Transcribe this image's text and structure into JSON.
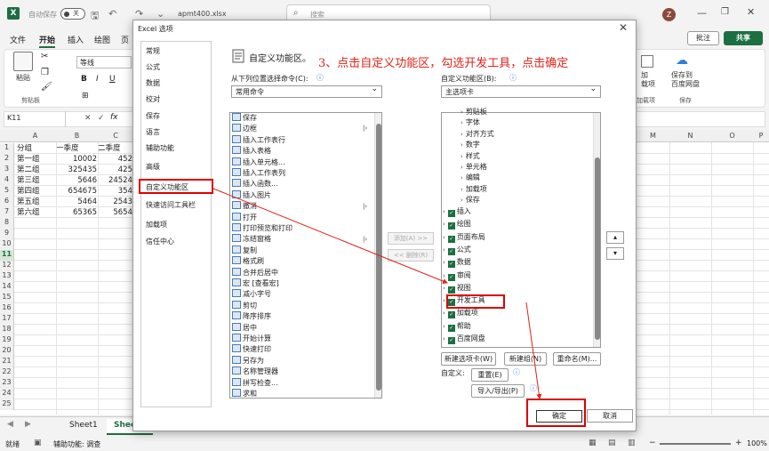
{
  "titlebar": {
    "autosave": "自动保存",
    "toggle": "关",
    "filename": "apmt400.xlsx",
    "search_placeholder": "搜索",
    "avatar": "Z"
  },
  "menu": [
    "文件",
    "开始",
    "插入",
    "绘图",
    "页"
  ],
  "header_buttons": {
    "comment": "批注",
    "share": "共享"
  },
  "ribbon": {
    "paste": "粘贴",
    "clipboard": "剪贴板",
    "font_name": "等线",
    "right_label1": "加\n载项",
    "addin_group": "加载项",
    "save_baidu": "保存到\n百度网盘",
    "save_group": "保存"
  },
  "formula": {
    "namebox": "K11",
    "fx": "fx"
  },
  "sheet": {
    "columns": [
      "A",
      "B",
      "C",
      "M",
      "N",
      "O",
      "P",
      "Q"
    ],
    "rows": [
      {
        "n": "1",
        "a": "分组",
        "b": "一季度",
        "c": "二季度"
      },
      {
        "n": "2",
        "a": "第一组",
        "b": "10002",
        "c": "452"
      },
      {
        "n": "3",
        "a": "第二组",
        "b": "325435",
        "c": "425"
      },
      {
        "n": "4",
        "a": "第三组",
        "b": "5646",
        "c": "24524"
      },
      {
        "n": "5",
        "a": "第四组",
        "b": "654675",
        "c": "354"
      },
      {
        "n": "6",
        "a": "第五组",
        "b": "5464",
        "c": "2543"
      },
      {
        "n": "7",
        "a": "第六组",
        "b": "65365",
        "c": "5654"
      },
      {
        "n": "8"
      },
      {
        "n": "9"
      },
      {
        "n": "10"
      },
      {
        "n": "11"
      },
      {
        "n": "12"
      },
      {
        "n": "13"
      },
      {
        "n": "14"
      },
      {
        "n": "15"
      },
      {
        "n": "16"
      },
      {
        "n": "17"
      },
      {
        "n": "18"
      },
      {
        "n": "19"
      },
      {
        "n": "20"
      },
      {
        "n": "21"
      },
      {
        "n": "22"
      },
      {
        "n": "23"
      },
      {
        "n": "24"
      },
      {
        "n": "25"
      }
    ]
  },
  "tabs": {
    "sheet1": "Sheet1",
    "sheet2": "Sheet2"
  },
  "status": {
    "ready": "就绪",
    "accessibility": "辅助功能: 调查",
    "zoom": "100%"
  },
  "dialog": {
    "title": "Excel 选项",
    "nav": [
      "常规",
      "公式",
      "数据",
      "校对",
      "保存",
      "语言",
      "辅助功能",
      "高级",
      "自定义功能区",
      "快速访问工具栏",
      "加载项",
      "信任中心"
    ],
    "heading": "自定义功能区。",
    "annotation": "3、点击自定义功能区，勾选开发工具，点击确定",
    "choose_from_label": "从下列位置选择命令(C):",
    "choose_from_value": "常用命令",
    "customize_label": "自定义功能区(B):",
    "customize_value": "主选项卡",
    "commands": [
      "保存",
      "边框",
      "插入工作表行",
      "插入表格",
      "插入单元格...",
      "插入工作表列",
      "插入函数...",
      "插入图片",
      "撤消",
      "打开",
      "打印预览和打印",
      "冻结窗格",
      "复制",
      "格式刷",
      "合并后居中",
      "宏 [查看宏]",
      "减小字号",
      "剪切",
      "降序排序",
      "居中",
      "开始计算",
      "快速打印",
      "另存为",
      "名称管理器",
      "拼写检查...",
      "求和"
    ],
    "add_button": "添加(A) >>",
    "remove_button": "<< 删除(R)",
    "tree_sub": [
      "剪贴板",
      "字体",
      "对齐方式",
      "数字",
      "样式",
      "单元格",
      "编辑",
      "加载项",
      "保存"
    ],
    "tree_main": [
      "插入",
      "绘图",
      "页面布局",
      "公式",
      "数据",
      "审阅",
      "视图",
      "开发工具",
      "加载项",
      "帮助",
      "百度网盘"
    ],
    "new_tab": "新建选项卡(W)",
    "new_group": "新建组(N)",
    "rename": "重命名(M)...",
    "customize": "自定义:",
    "reset": "重置(E)",
    "import_export": "导入/导出(P)",
    "ok": "确定",
    "cancel": "取消"
  }
}
